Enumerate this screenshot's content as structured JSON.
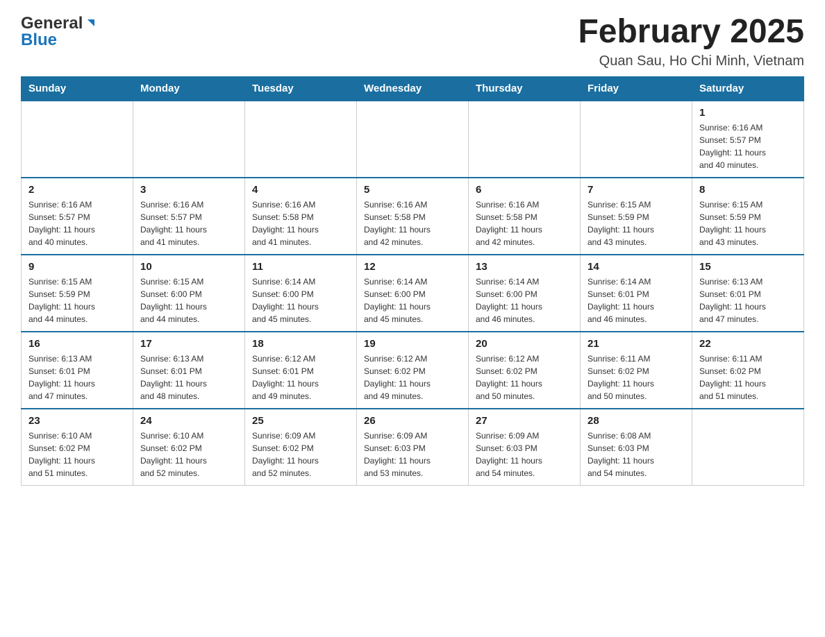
{
  "header": {
    "logo_general": "General",
    "logo_blue": "Blue",
    "title": "February 2025",
    "subtitle": "Quan Sau, Ho Chi Minh, Vietnam"
  },
  "weekdays": [
    "Sunday",
    "Monday",
    "Tuesday",
    "Wednesday",
    "Thursday",
    "Friday",
    "Saturday"
  ],
  "weeks": [
    [
      {
        "day": "",
        "info": ""
      },
      {
        "day": "",
        "info": ""
      },
      {
        "day": "",
        "info": ""
      },
      {
        "day": "",
        "info": ""
      },
      {
        "day": "",
        "info": ""
      },
      {
        "day": "",
        "info": ""
      },
      {
        "day": "1",
        "info": "Sunrise: 6:16 AM\nSunset: 5:57 PM\nDaylight: 11 hours\nand 40 minutes."
      }
    ],
    [
      {
        "day": "2",
        "info": "Sunrise: 6:16 AM\nSunset: 5:57 PM\nDaylight: 11 hours\nand 40 minutes."
      },
      {
        "day": "3",
        "info": "Sunrise: 6:16 AM\nSunset: 5:57 PM\nDaylight: 11 hours\nand 41 minutes."
      },
      {
        "day": "4",
        "info": "Sunrise: 6:16 AM\nSunset: 5:58 PM\nDaylight: 11 hours\nand 41 minutes."
      },
      {
        "day": "5",
        "info": "Sunrise: 6:16 AM\nSunset: 5:58 PM\nDaylight: 11 hours\nand 42 minutes."
      },
      {
        "day": "6",
        "info": "Sunrise: 6:16 AM\nSunset: 5:58 PM\nDaylight: 11 hours\nand 42 minutes."
      },
      {
        "day": "7",
        "info": "Sunrise: 6:15 AM\nSunset: 5:59 PM\nDaylight: 11 hours\nand 43 minutes."
      },
      {
        "day": "8",
        "info": "Sunrise: 6:15 AM\nSunset: 5:59 PM\nDaylight: 11 hours\nand 43 minutes."
      }
    ],
    [
      {
        "day": "9",
        "info": "Sunrise: 6:15 AM\nSunset: 5:59 PM\nDaylight: 11 hours\nand 44 minutes."
      },
      {
        "day": "10",
        "info": "Sunrise: 6:15 AM\nSunset: 6:00 PM\nDaylight: 11 hours\nand 44 minutes."
      },
      {
        "day": "11",
        "info": "Sunrise: 6:14 AM\nSunset: 6:00 PM\nDaylight: 11 hours\nand 45 minutes."
      },
      {
        "day": "12",
        "info": "Sunrise: 6:14 AM\nSunset: 6:00 PM\nDaylight: 11 hours\nand 45 minutes."
      },
      {
        "day": "13",
        "info": "Sunrise: 6:14 AM\nSunset: 6:00 PM\nDaylight: 11 hours\nand 46 minutes."
      },
      {
        "day": "14",
        "info": "Sunrise: 6:14 AM\nSunset: 6:01 PM\nDaylight: 11 hours\nand 46 minutes."
      },
      {
        "day": "15",
        "info": "Sunrise: 6:13 AM\nSunset: 6:01 PM\nDaylight: 11 hours\nand 47 minutes."
      }
    ],
    [
      {
        "day": "16",
        "info": "Sunrise: 6:13 AM\nSunset: 6:01 PM\nDaylight: 11 hours\nand 47 minutes."
      },
      {
        "day": "17",
        "info": "Sunrise: 6:13 AM\nSunset: 6:01 PM\nDaylight: 11 hours\nand 48 minutes."
      },
      {
        "day": "18",
        "info": "Sunrise: 6:12 AM\nSunset: 6:01 PM\nDaylight: 11 hours\nand 49 minutes."
      },
      {
        "day": "19",
        "info": "Sunrise: 6:12 AM\nSunset: 6:02 PM\nDaylight: 11 hours\nand 49 minutes."
      },
      {
        "day": "20",
        "info": "Sunrise: 6:12 AM\nSunset: 6:02 PM\nDaylight: 11 hours\nand 50 minutes."
      },
      {
        "day": "21",
        "info": "Sunrise: 6:11 AM\nSunset: 6:02 PM\nDaylight: 11 hours\nand 50 minutes."
      },
      {
        "day": "22",
        "info": "Sunrise: 6:11 AM\nSunset: 6:02 PM\nDaylight: 11 hours\nand 51 minutes."
      }
    ],
    [
      {
        "day": "23",
        "info": "Sunrise: 6:10 AM\nSunset: 6:02 PM\nDaylight: 11 hours\nand 51 minutes."
      },
      {
        "day": "24",
        "info": "Sunrise: 6:10 AM\nSunset: 6:02 PM\nDaylight: 11 hours\nand 52 minutes."
      },
      {
        "day": "25",
        "info": "Sunrise: 6:09 AM\nSunset: 6:02 PM\nDaylight: 11 hours\nand 52 minutes."
      },
      {
        "day": "26",
        "info": "Sunrise: 6:09 AM\nSunset: 6:03 PM\nDaylight: 11 hours\nand 53 minutes."
      },
      {
        "day": "27",
        "info": "Sunrise: 6:09 AM\nSunset: 6:03 PM\nDaylight: 11 hours\nand 54 minutes."
      },
      {
        "day": "28",
        "info": "Sunrise: 6:08 AM\nSunset: 6:03 PM\nDaylight: 11 hours\nand 54 minutes."
      },
      {
        "day": "",
        "info": ""
      }
    ]
  ]
}
